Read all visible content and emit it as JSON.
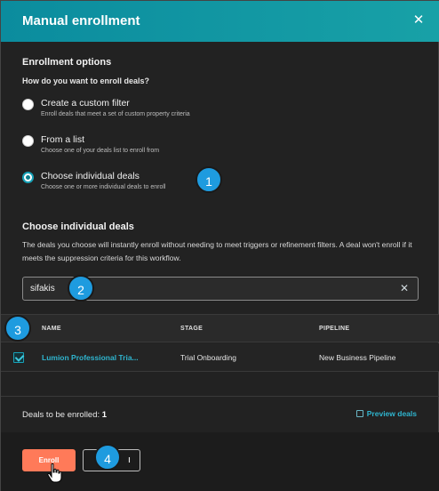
{
  "modal": {
    "title": "Manual enrollment",
    "close_icon": "close-icon"
  },
  "enrollment_options": {
    "heading": "Enrollment options",
    "question": "How do you want to enroll deals?",
    "options": [
      {
        "label": "Create a custom filter",
        "description": "Enroll deals that meet a set of custom property criteria",
        "selected": false
      },
      {
        "label": "From a list",
        "description": "Choose one of your deals list to enroll from",
        "selected": false
      },
      {
        "label": "Choose individual deals",
        "description": "Choose one or more individual deals to enroll",
        "selected": true
      }
    ]
  },
  "individual_deals": {
    "heading": "Choose individual deals",
    "description": "The deals you choose will instantly enroll without needing to meet triggers or refinement filters. A deal won't enroll if it meets the suppression criteria for this workflow.",
    "search_value": "sifakis"
  },
  "table": {
    "columns": [
      "NAME",
      "STAGE",
      "PIPELINE"
    ],
    "rows": [
      {
        "checked": true,
        "name": "Lumion Professional Tria...",
        "stage": "Trial Onboarding",
        "pipeline": "New Business Pipeline"
      }
    ]
  },
  "summary": {
    "count_label": "Deals to be enrolled:",
    "count": "1",
    "preview_label": "Preview deals"
  },
  "footer": {
    "enroll_label": "Enroll",
    "cancel_label": "l"
  },
  "callouts": [
    "1",
    "2",
    "3",
    "4"
  ],
  "colors": {
    "header_start": "#0b8c9e",
    "header_end": "#18a1a7",
    "accent": "#2fb5cf",
    "primary_button": "#ff7a59",
    "callout": "#1e9bdf",
    "background": "#222222"
  }
}
